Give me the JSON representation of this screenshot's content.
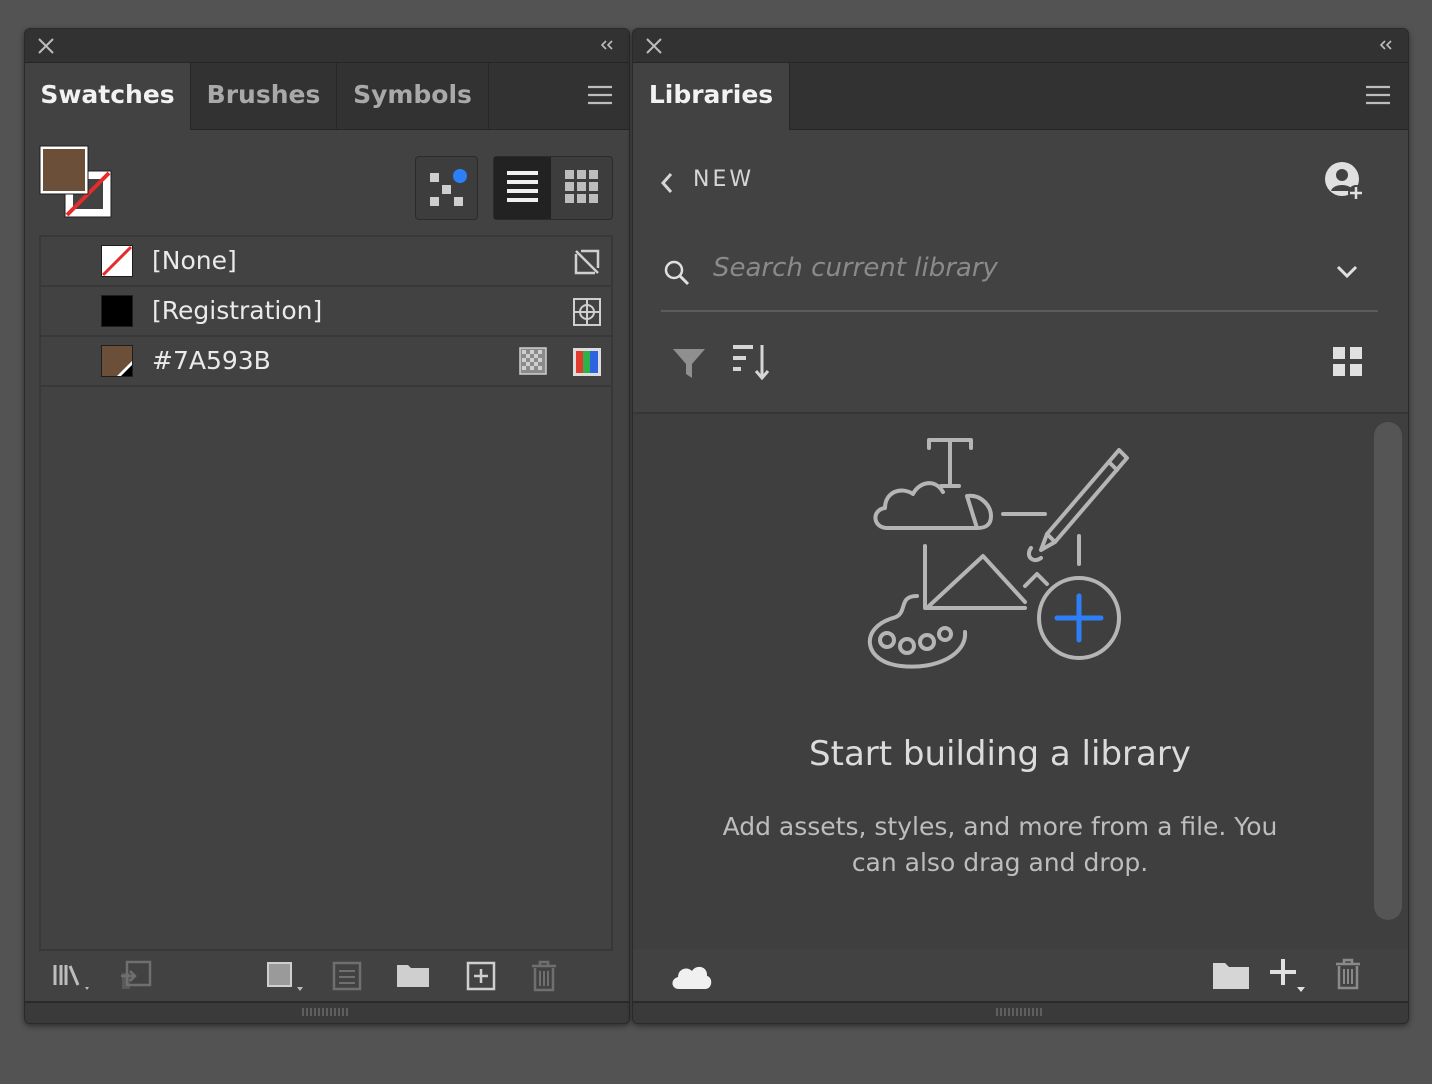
{
  "swatches_panel": {
    "tabs": [
      {
        "label": "Swatches",
        "active": true
      },
      {
        "label": "Brushes",
        "active": false
      },
      {
        "label": "Symbols",
        "active": false
      }
    ],
    "fill_color": "#6b4f38",
    "swatches": [
      {
        "name": "[None]",
        "chip": "none",
        "icons": [
          "no-edit-icon"
        ]
      },
      {
        "name": "[Registration]",
        "chip": "#000000",
        "icons": [
          "registration-icon"
        ]
      },
      {
        "name": "#7A593B",
        "chip": "#6b4f38",
        "icons": [
          "process-color-icon",
          "rgb-mode-icon"
        ]
      }
    ]
  },
  "libraries_panel": {
    "tab_label": "Libraries",
    "back_label": "NEW",
    "search_placeholder": "Search current library",
    "empty_title": "Start building a library",
    "empty_description": "Add assets, styles, and more from a file. You can also drag and drop.",
    "accent_color": "#2d7ff9"
  }
}
